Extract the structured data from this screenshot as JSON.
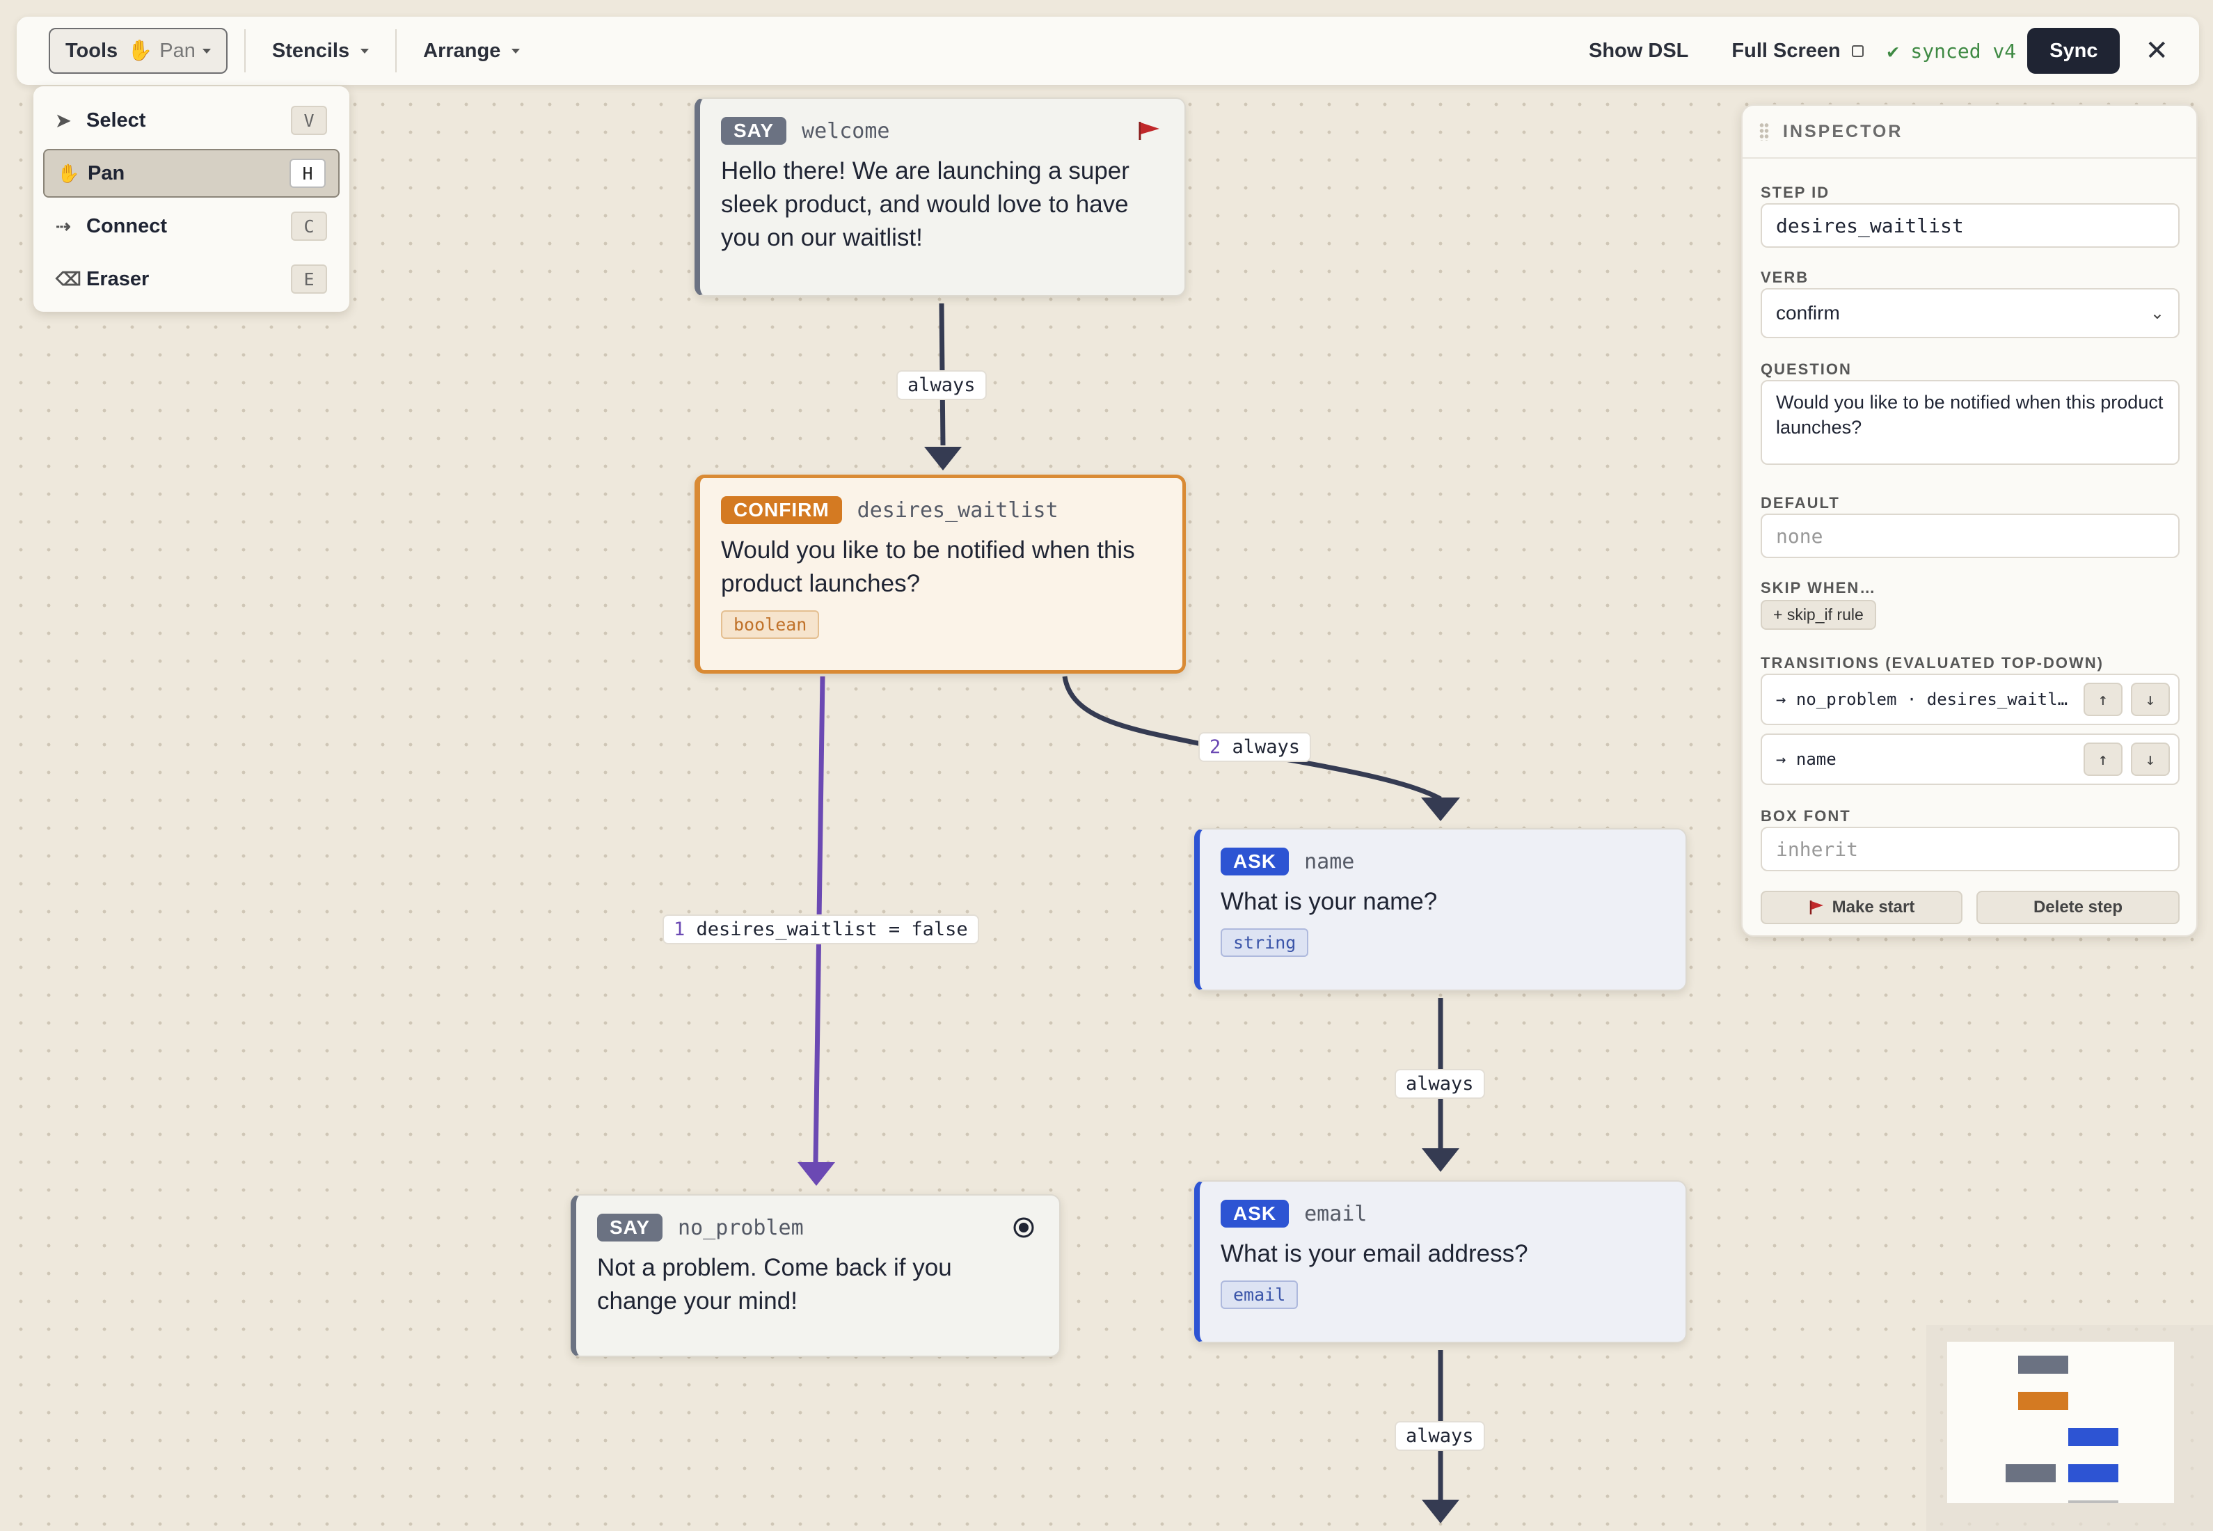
{
  "toolbar": {
    "tools_label": "Tools",
    "tools_current": "Pan",
    "tools_current_icon": "hand-icon",
    "stencils_label": "Stencils",
    "arrange_label": "Arrange",
    "show_dsl_label": "Show DSL",
    "full_screen_label": "Full Screen",
    "synced_text": "✔ synced v4",
    "sync_label": "Sync",
    "close_label": "✕"
  },
  "tools_menu": {
    "items": [
      {
        "label": "Select",
        "key": "V",
        "icon": "cursor-icon",
        "glyph": "➤"
      },
      {
        "label": "Pan",
        "key": "H",
        "icon": "hand-icon",
        "glyph": "✋",
        "active": true
      },
      {
        "label": "Connect",
        "key": "C",
        "icon": "connect-icon",
        "glyph": "⇢"
      },
      {
        "label": "Eraser",
        "key": "E",
        "icon": "eraser-icon",
        "glyph": "⌫"
      }
    ]
  },
  "nodes": {
    "welcome": {
      "verb": "SAY",
      "id": "welcome",
      "text": "Hello there! We are launching a super sleek product, and would love to have you on our waitlist!",
      "start_flag": "start-flag-icon"
    },
    "desires_waitlist": {
      "verb": "CONFIRM",
      "id": "desires_waitlist",
      "text": "Would you like to be notified when this product launches?",
      "type": "boolean"
    },
    "name": {
      "verb": "ASK",
      "id": "name",
      "text": "What is your name?",
      "type": "string"
    },
    "no_problem": {
      "verb": "SAY",
      "id": "no_problem",
      "text": "Not a problem. Come back if you change your mind!",
      "end_marker": "end-radio-icon"
    },
    "email": {
      "verb": "ASK",
      "id": "email",
      "text": "What is your email address?",
      "type": "email"
    }
  },
  "edges": {
    "welcome_to_confirm": "always",
    "confirm_to_name_num": "2",
    "confirm_to_name": "always",
    "confirm_to_no_problem_num": "1",
    "confirm_to_no_problem": "desires_waitlist = false",
    "name_to_email": "always",
    "email_to_next": "always"
  },
  "inspector": {
    "title": "INSPECTOR",
    "step_id_label": "STEP ID",
    "step_id_value": "desires_waitlist",
    "verb_label": "VERB",
    "verb_value": "confirm",
    "question_label": "QUESTION",
    "question_value": "Would you like to be notified when this product launches?",
    "default_label": "DEFAULT",
    "default_placeholder": "none",
    "skip_label": "SKIP WHEN…",
    "skip_button": "+ skip_if rule",
    "transitions_label": "TRANSITIONS (EVALUATED TOP-DOWN)",
    "transitions": [
      {
        "text": "→ no_problem · desires_waitlist = false"
      },
      {
        "text": "→ name"
      }
    ],
    "up_glyph": "↑",
    "down_glyph": "↓",
    "box_font_label": "BOX FONT",
    "box_font_placeholder": "inherit",
    "make_start_label": "Make start",
    "delete_step_label": "Delete step"
  },
  "colors": {
    "say": "#6b7282",
    "confirm": "#d47a22",
    "ask": "#2d54d3",
    "edge": "#353b52",
    "false_edge": "#6b49b3",
    "synced": "#3f8a44"
  }
}
